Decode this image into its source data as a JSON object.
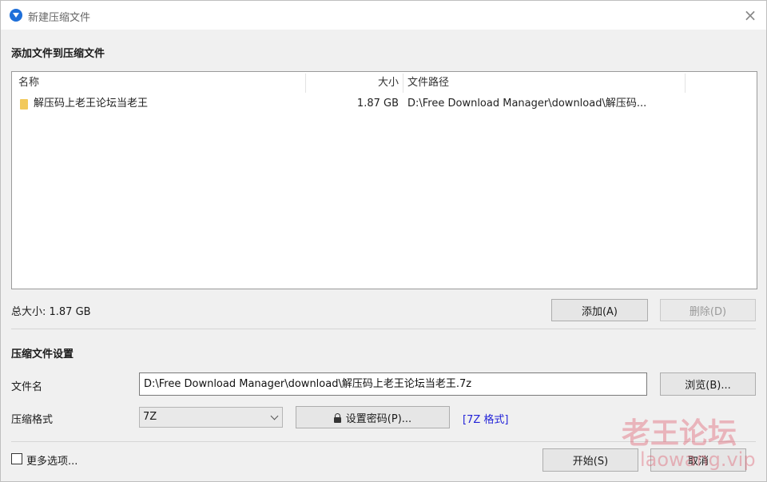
{
  "titlebar": {
    "title": "新建压缩文件",
    "close_glyph": "×",
    "app_icon": "circle-arrow-icon"
  },
  "files_section": {
    "heading": "添加文件到压缩文件",
    "columns": [
      "名称",
      "大小",
      "文件路径"
    ],
    "rows": [
      {
        "name": "解压码上老王论坛当老王",
        "size": "1.87 GB",
        "path": "D:\\Free Download Manager\\download\\解压码...",
        "icon": "folder-icon"
      }
    ],
    "total_size": "总大小: 1.87 GB",
    "add_button": "添加(A)",
    "delete_button": "删除(D)"
  },
  "settings": {
    "heading": "压缩文件设置",
    "filename_label": "文件名",
    "filename_value": "D:\\Free Download Manager\\download\\解压码上老王论坛当老王.7z",
    "browse_button": "浏览(B)...",
    "format_label": "压缩格式",
    "format_value": "7Z",
    "password_button": "设置密码(P)...",
    "format_link": "[7Z 格式]"
  },
  "footer": {
    "more_options": "更多选项...",
    "start_button": "开始(S)",
    "cancel_button": "取消"
  },
  "watermark": {
    "line1": "老王论坛",
    "line2": "laowang.vip"
  },
  "colors": {
    "accent": "#1e6fd9",
    "link": "#2323d8",
    "window_bg": "#f0f0f0"
  }
}
